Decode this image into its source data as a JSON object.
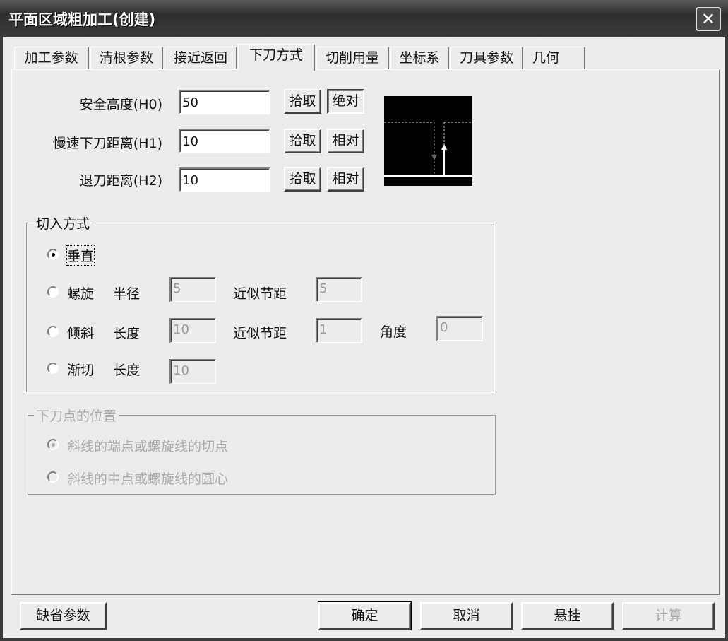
{
  "window": {
    "title": "平面区域粗加工(创建)",
    "close_icon": "close-icon"
  },
  "tabs": [
    {
      "label": "加工参数"
    },
    {
      "label": "清根参数"
    },
    {
      "label": "接近返回"
    },
    {
      "label": "下刀方式",
      "selected": true
    },
    {
      "label": "切削用量"
    },
    {
      "label": "坐标系"
    },
    {
      "label": "刀具参数"
    },
    {
      "label": "几何"
    }
  ],
  "heights": [
    {
      "label": "安全高度(H0)",
      "value": "50",
      "pick": "拾取",
      "mode": "绝对"
    },
    {
      "label": "慢速下刀距离(H1)",
      "value": "10",
      "pick": "拾取",
      "mode": "相对"
    },
    {
      "label": "退刀距离(H2)",
      "value": "10",
      "pick": "拾取",
      "mode": "相对"
    }
  ],
  "entry": {
    "title": "切入方式",
    "vertical": "垂直",
    "helix": {
      "label": "螺旋",
      "radius_label": "半径",
      "radius": "5",
      "pitch_label": "近似节距",
      "pitch": "5"
    },
    "ramp": {
      "label": "倾斜",
      "length_label": "长度",
      "length": "10",
      "pitch_label": "近似节距",
      "pitch": "1",
      "angle_label": "角度",
      "angle": "0"
    },
    "tangent": {
      "label": "渐切",
      "length_label": "长度",
      "length": "10"
    },
    "selected": "vertical"
  },
  "position": {
    "title": "下刀点的位置",
    "opt1": "斜线的端点或螺旋线的切点",
    "opt2": "斜线的中点或螺旋线的圆心"
  },
  "buttons": {
    "defaults": "缺省参数",
    "ok": "确定",
    "cancel": "取消",
    "suspend": "悬挂",
    "compute": "计算"
  }
}
